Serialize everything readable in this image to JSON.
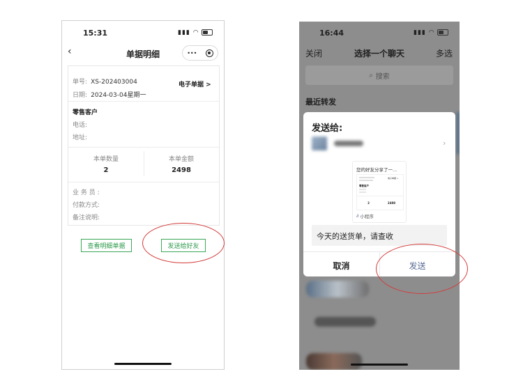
{
  "left_screen": {
    "status_time": "15:31",
    "nav_back_icon": "chevron-left-icon",
    "nav_title": "单据明细",
    "capsule_more": "•••",
    "capsule_close_icon": "target-icon",
    "order": {
      "number_label": "单号:",
      "number_value": "XS-202403004",
      "date_label": "日期:",
      "date_value": "2024-03-04星期一",
      "e_receipt_link": "电子单据 >"
    },
    "customer": {
      "name": "零售客户",
      "phone_label": "电话:",
      "address_label": "地址:"
    },
    "summary": {
      "qty_label": "本单数量",
      "qty_value": "2",
      "amount_label": "本单金额",
      "amount_value": "2498"
    },
    "extra": {
      "salesperson_label": "业 务 员 :",
      "payment_label": "付款方式:",
      "remark_label": "备注说明:"
    },
    "buttons": {
      "view_detail": "查看明细单据",
      "send_friend": "发送给好友"
    }
  },
  "right_screen": {
    "status_time": "16:44",
    "header": {
      "close": "关闭",
      "title": "选择一个聊天",
      "multi": "多选"
    },
    "search_placeholder": "搜索",
    "section_title": "最近转发",
    "dialog": {
      "title": "发送给:",
      "preview_caption": "您的好友分享了一...",
      "mini_program_label": "小程序",
      "preview_receipt": {
        "customer": "零售客户",
        "e_link": "电子单据 >",
        "qty": "2",
        "amount": "2498"
      },
      "message": "今天的送货单，请查收",
      "cancel": "取消",
      "send": "发送"
    }
  },
  "colors": {
    "accent_green": "#2e9b4b",
    "send_blue": "#576b95",
    "highlight_red": "#d43a3a"
  }
}
